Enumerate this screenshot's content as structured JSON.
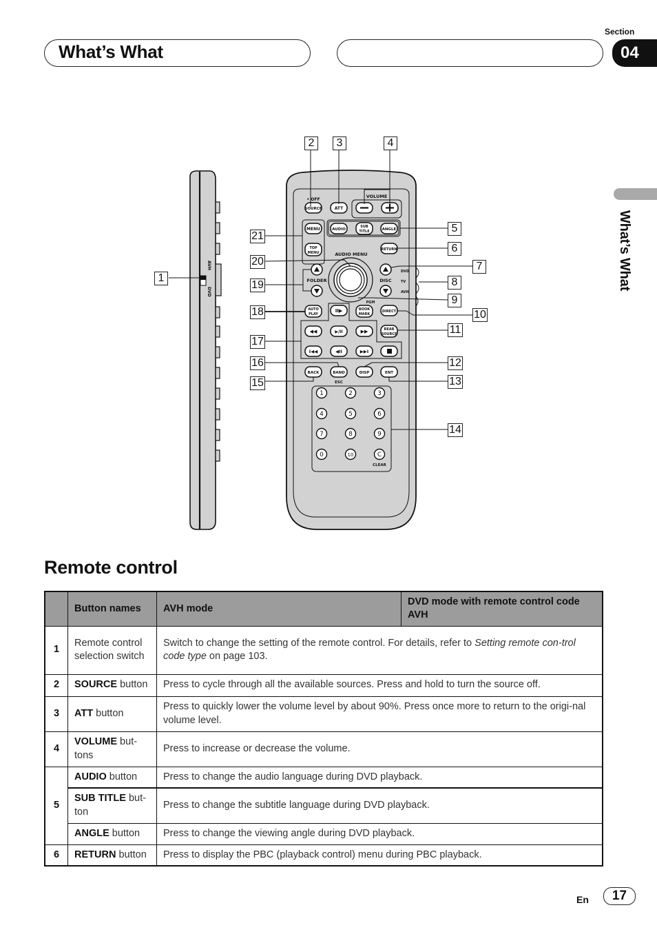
{
  "header": {
    "section_label": "Section",
    "section_number": "04",
    "title": "What’s What",
    "right_pill_text": ""
  },
  "side_tab": {
    "label": "What’s What"
  },
  "diagram": {
    "callouts": [
      "1",
      "2",
      "3",
      "4",
      "5",
      "6",
      "7",
      "8",
      "9",
      "10",
      "11",
      "12",
      "13",
      "14",
      "15",
      "16",
      "17",
      "18",
      "19",
      "20",
      "21"
    ],
    "remote_labels": {
      "off": "• OFF",
      "source": "SOURCE",
      "att": "ATT",
      "volume": "VOLUME",
      "minus": "—",
      "plus": "+",
      "menu": "MENU",
      "top_menu_1": "TOP",
      "top_menu_2": "MENU",
      "audio": "AUDIO",
      "sub_title_1": "SUB",
      "sub_title_2": "TITLE",
      "angle": "ANGLE",
      "return": "RETURN",
      "audio_menu": "AUDIO MENU",
      "folder": "FOLDER",
      "disc": "DISC",
      "dvd": "DVD",
      "tv": "TV",
      "avh": "AVH",
      "auto_play_1": "AUTO",
      "auto_play_2": "PLAY",
      "pgm": "PGM",
      "book_mark_1": "BOOK",
      "book_mark_2": "MARK",
      "direct": "DIRECT",
      "rear_source_1": "REAR",
      "rear_source_2": "SOURCE",
      "back": "BACK",
      "band": "BAND",
      "esc": "ESC",
      "disp": "DISP",
      "ent": "ENT",
      "clear": "CLEAR",
      "side_avh": "AVH",
      "side_dvd": "DVD",
      "keypad": [
        "1",
        "2",
        "3",
        "4",
        "5",
        "6",
        "7",
        "8",
        "9",
        "0",
        "10",
        "C"
      ]
    }
  },
  "section_heading": "Remote control",
  "table": {
    "headers": [
      "",
      "Button names",
      "AVH mode",
      "DVD mode with remote control code AVH"
    ],
    "rows": [
      {
        "num": "1",
        "name_bold": "",
        "name_rest": "Remote control selection switch",
        "desc_pre": "Switch to change the setting of the remote control. For details, refer to ",
        "desc_italic": "Setting remote con-trol code type",
        "desc_post": " on page 103."
      },
      {
        "num": "2",
        "name_bold": "SOURCE",
        "name_rest": " button",
        "desc": "Press to cycle through all the available sources. Press and hold to turn the source off."
      },
      {
        "num": "3",
        "name_bold": "ATT",
        "name_rest": " button",
        "desc": "Press to quickly lower the volume level by about 90%. Press once more to return to the origi-nal volume level."
      },
      {
        "num": "4",
        "name_bold": "VOLUME",
        "name_rest": " but-tons",
        "desc": "Press to increase or decrease the volume."
      },
      {
        "num": "5",
        "name_bold": "AUDIO",
        "name_rest": " button",
        "desc": "Press to change the audio language during DVD playback."
      },
      {
        "num": "",
        "name_bold": "SUB TITLE",
        "name_rest": " but-ton",
        "desc": "Press to change the subtitle language during DVD playback."
      },
      {
        "num": "",
        "name_bold": "ANGLE",
        "name_rest": " button",
        "desc": "Press to change the viewing angle during DVD playback."
      },
      {
        "num": "6",
        "name_bold": "RETURN",
        "name_rest": " button",
        "desc": "Press to display the PBC (playback control) menu during PBC playback."
      }
    ]
  },
  "footer": {
    "language": "En",
    "page_number": "17"
  }
}
